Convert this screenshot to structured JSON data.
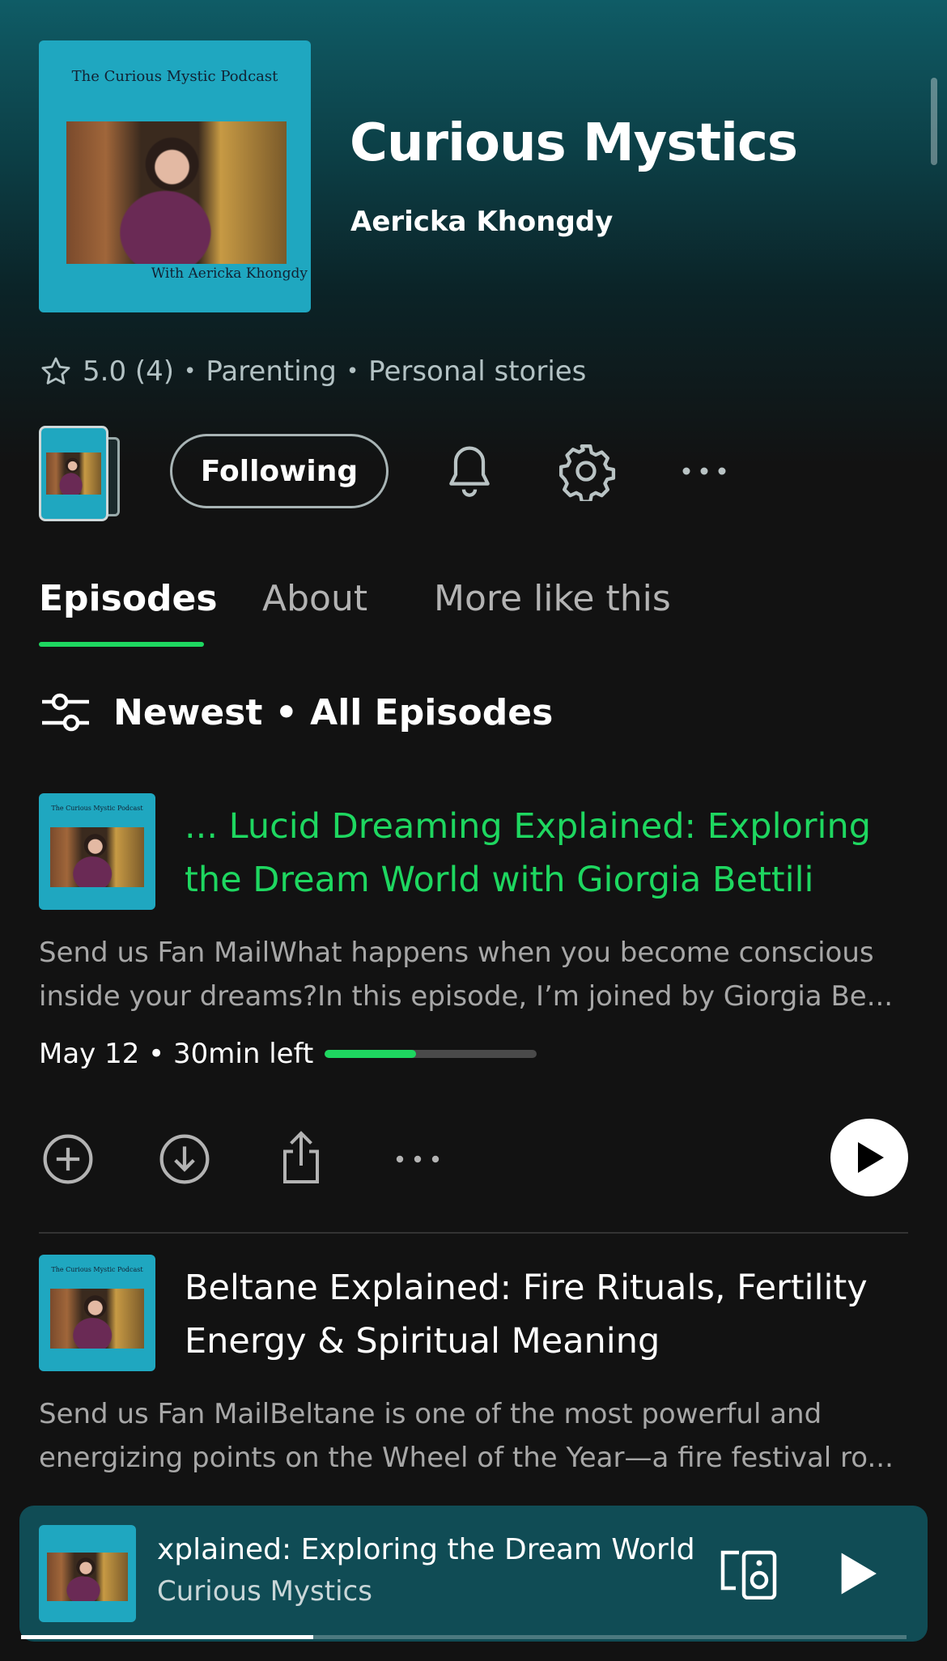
{
  "show": {
    "cover_title": "The Curious Mystic Podcast",
    "cover_byline": "With Aericka Khongdy",
    "title": "Curious Mystics",
    "author": "Aericka Khongdy",
    "rating": "5.0 (4)",
    "categories": [
      "Parenting",
      "Personal stories"
    ],
    "separator": "•"
  },
  "actions": {
    "following_label": "Following"
  },
  "tabs": [
    {
      "label": "Episodes",
      "active": true
    },
    {
      "label": "About",
      "active": false
    },
    {
      "label": "More like this",
      "active": false
    }
  ],
  "sort": {
    "label": "Newest • All Episodes"
  },
  "episodes": [
    {
      "title_line1": "... Lucid Dreaming Explained: Exploring",
      "title_line2": "the Dream World with Giorgia Bettili",
      "desc_line1": "Send us Fan MailWhat happens when you become conscious",
      "desc_line2": "inside your dreams?In this episode, I’m joined by Giorgia Be...",
      "meta": "May 12 • 30min left",
      "progress": 0.43,
      "now_playing": true
    },
    {
      "title_line1": "Beltane Explained: Fire Rituals, Fertility",
      "title_line2": "Energy & Spiritual Meaning",
      "desc_line1": "Send us Fan MailBeltane is one of the most powerful and",
      "desc_line2": "energizing points on the Wheel of the Year—a fire festival ro...",
      "now_playing": false
    }
  ],
  "player": {
    "title": "xplained: Exploring the Dream World",
    "subtitle": "Curious Mystics",
    "progress": 0.33
  },
  "colors": {
    "accent": "#1ed760",
    "player_bg": "#104c55",
    "cover_bg": "#1fa7c0"
  }
}
